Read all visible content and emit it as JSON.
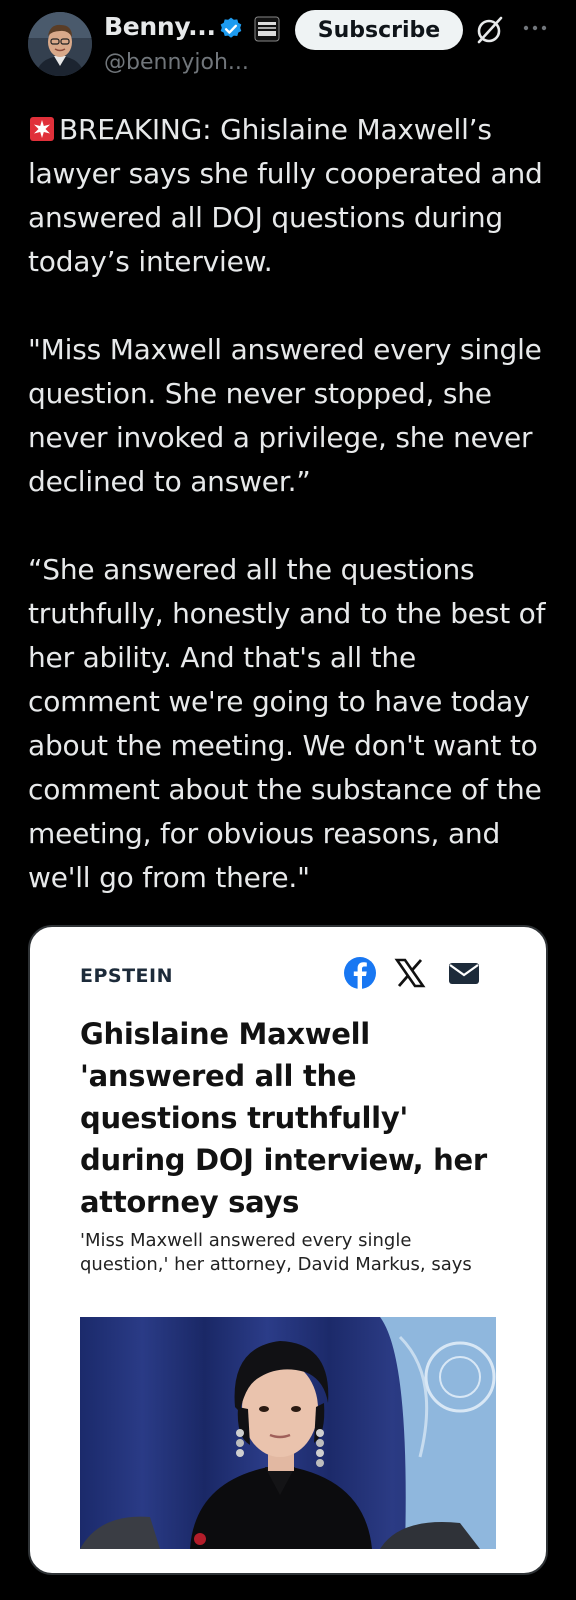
{
  "author": {
    "display_name": "Benny...",
    "handle": "@bennyjoh...",
    "verified": true,
    "avatar_icon": "profile-photo",
    "affiliate_icon": "affiliate-badge-icon"
  },
  "header": {
    "subscribe_label": "Subscribe",
    "grok_icon": "grok-icon",
    "more_icon": "more-dots-icon"
  },
  "tweet": {
    "emoji": "police-siren",
    "paragraph1": "BREAKING: Ghislaine Maxwell’s lawyer says she fully cooperated and answered all DOJ questions during today’s interview.",
    "paragraph2": "\"Miss Maxwell answered every single question. She never stopped, she never invoked a privilege, she never declined to answer.”",
    "paragraph3": "“She answered all the questions truthfully, honestly and to the best of her ability. And that's all the comment we're going to have today about the meeting. We don't want to comment about the substance of the meeting, for obvious reasons, and we'll go from there.\""
  },
  "card": {
    "category": "EPSTEIN",
    "headline": "Ghislaine Maxwell 'answered all the questions truthfully' during DOJ interview, her attorney says",
    "subheadline": "'Miss Maxwell answered every single question,' her attorney, David Markus, says",
    "share_icons": [
      "facebook-icon",
      "x-icon",
      "email-icon"
    ]
  },
  "colors": {
    "background": "#000000",
    "text": "#e7e9ea",
    "muted": "#71767b",
    "verified_blue": "#1d9bf0",
    "facebook_blue": "#1877f2"
  }
}
